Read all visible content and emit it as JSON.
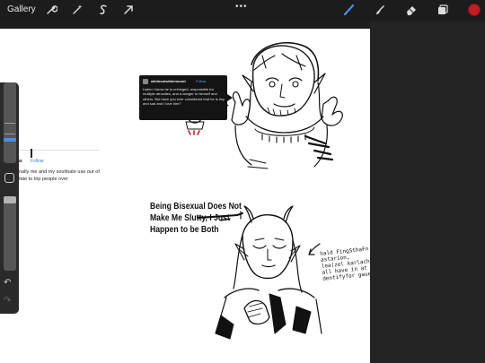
{
  "toolbar": {
    "gallery_label": "Gallery",
    "left_icons": [
      "wrench-icon",
      "magic-wand-icon",
      "selection-s-icon",
      "transform-arrow-icon"
    ],
    "right_icons": [
      "brush-icon",
      "smudge-icon",
      "eraser-icon",
      "layers-icon"
    ],
    "more_label": "•••",
    "active_color": "#c21d24",
    "accent": "#4c8de6"
  },
  "canvas": {
    "fragment": {
      "username": "ns",
      "follow_label": "Follow",
      "text": "nally me and my soulmate use our of fate to trip people over"
    },
    "post": {
      "username": "wildnoutwildemount",
      "follow_label": "Follow",
      "text": "Listen I know  he is unhinged, responsible for multiple atrocities, and a danger to himself and others. But have you ever considered that  he is tiny and sad and I love him?"
    },
    "caption": "Being Bisexual Does Not Make Me Slutty, I Just Happen to be Both",
    "note": "hald FingSthaFn astarion, lea(zel karlach, all have in at dentifyfor gaue"
  },
  "sidebar": {
    "undo_label": "↶",
    "redo_label": "↷"
  }
}
